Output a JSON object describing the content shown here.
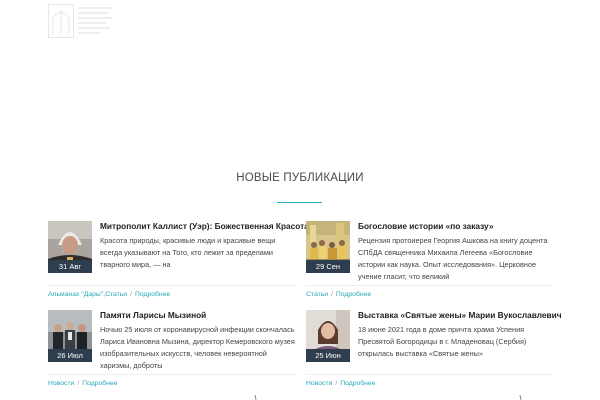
{
  "section": {
    "title": "НОВЫЕ ПУБЛИКАЦИИ"
  },
  "posts": [
    {
      "date": "31 Авг",
      "title": "Митрополит Каллист (Уэр): Божественная Красота",
      "excerpt": "Красота природы, красивые люди и красивые вещи всегда указывают на Того, кто лежит за пределами тварного мира, — на",
      "categories": "Альманах \"Дары\",Статьи",
      "more": "Подробнее",
      "thumb": "portrait-elder-bishop"
    },
    {
      "date": "29 Сен",
      "title": "Богословие истории «по заказу»",
      "excerpt": "Рецензия протоиерея Георгия Ашкова на книгу доцента СПбДА священника Михаила Легеева «Богословие истории как наука. Опыт исследования». Церковное учение гласит, что великий",
      "categories": "Статьи",
      "more": "Подробнее",
      "thumb": "procession-crowd"
    },
    {
      "date": "26 Июл",
      "title": "Памяти Ларисы Мызиной",
      "excerpt": "Ночью 25 июля от коронавирусной инфекции скончалась Лариса Ивановна Мызина, директор Кемеровского музея изобразительных искусств, человек невероятной харизмы, доброты",
      "categories": "Новости",
      "more": "Подробнее",
      "thumb": "group-portrait"
    },
    {
      "date": "25 Июн",
      "title": "Выставка «Святые жены» Марии Вукославлевич",
      "excerpt": "18 июне 2021 года в доме причта храма Успения Пресвятой Богородицы в г. Младеновац (Сербия) открылась выставка «Святые жены»",
      "categories": "Новости",
      "more": "Подробнее",
      "thumb": "woman-portrait"
    }
  ]
}
